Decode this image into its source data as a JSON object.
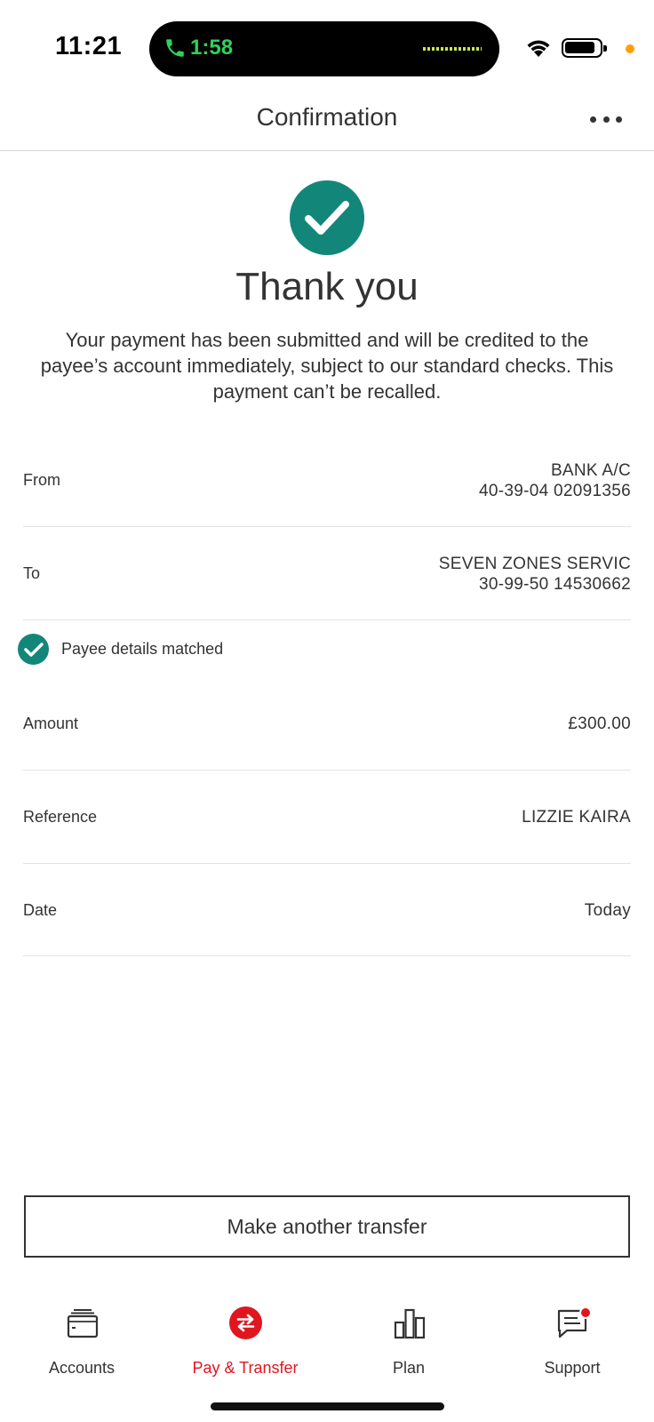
{
  "status_bar": {
    "time": "11:21",
    "call_timer": "1:58",
    "call_color": "#30d158",
    "privacy_dot_color": "#ff9f0a"
  },
  "header": {
    "title": "Confirmation",
    "more_icon": "more-horizontal-icon"
  },
  "success": {
    "icon": "check-circle-icon",
    "heading": "Thank you",
    "message": "Your payment has been submitted and will be credited to the payee’s account immediately, subject to our standard checks. This payment can’t be recalled.",
    "accent_color": "#13867a"
  },
  "details": {
    "from": {
      "label": "From",
      "account_name": "BANK A/C",
      "account_number": "40-39-04 02091356"
    },
    "to": {
      "label": "To",
      "account_name": "SEVEN ZONES SERVIC",
      "account_number": "30-99-50 14530662"
    },
    "payee_match": {
      "label": "Payee details matched",
      "icon": "check-circle-icon"
    },
    "amount": {
      "label": "Amount",
      "value": "£300.00"
    },
    "reference": {
      "label": "Reference",
      "value": "LIZZIE KAIRA"
    },
    "date": {
      "label": "Date",
      "value": "Today"
    }
  },
  "actions": {
    "make_another_transfer": "Make another transfer"
  },
  "tabbar": {
    "active_color": "#e0161f",
    "items": [
      {
        "label": "Accounts",
        "icon": "wallet-icon",
        "active": false
      },
      {
        "label": "Pay & Transfer",
        "icon": "transfer-icon",
        "active": true
      },
      {
        "label": "Plan",
        "icon": "bar-chart-icon",
        "active": false
      },
      {
        "label": "Support",
        "icon": "chat-icon",
        "active": false,
        "notification": true
      }
    ]
  }
}
